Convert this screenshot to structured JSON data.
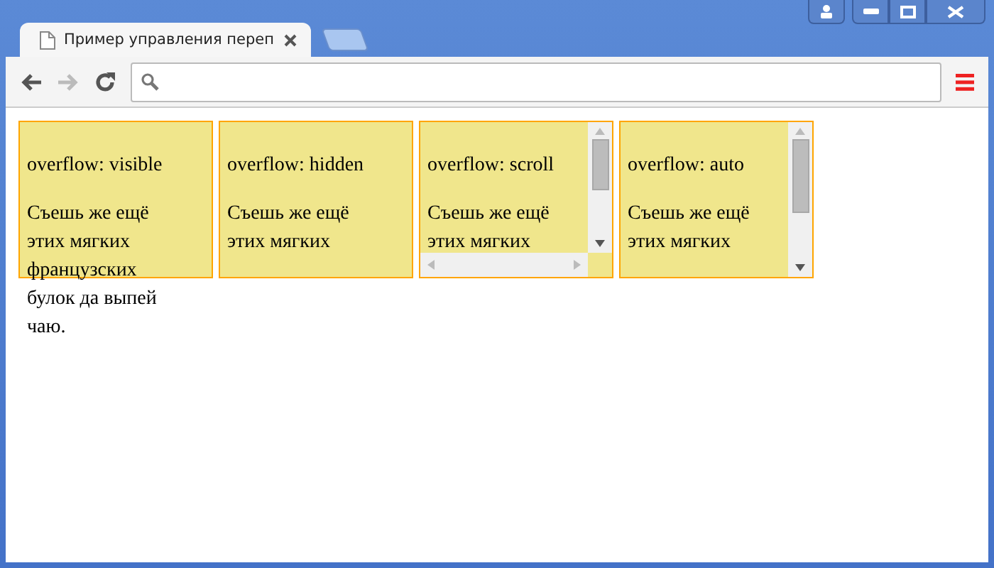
{
  "tab": {
    "title": "Пример управления переп",
    "selected": true
  },
  "boxes": [
    {
      "kind": "visible",
      "heading": "overflow: visible",
      "text": "Съешь же ещё этих мягких французских булок да выпей чаю."
    },
    {
      "kind": "hidden",
      "heading": "overflow: hidden",
      "text": "Съешь же ещё этих мягких"
    },
    {
      "kind": "scroll",
      "heading": "overflow: scroll",
      "text": "Съешь же ещё этих мягких"
    },
    {
      "kind": "auto",
      "heading": "overflow: auto",
      "text": "Съешь же ещё этих мягких"
    }
  ]
}
